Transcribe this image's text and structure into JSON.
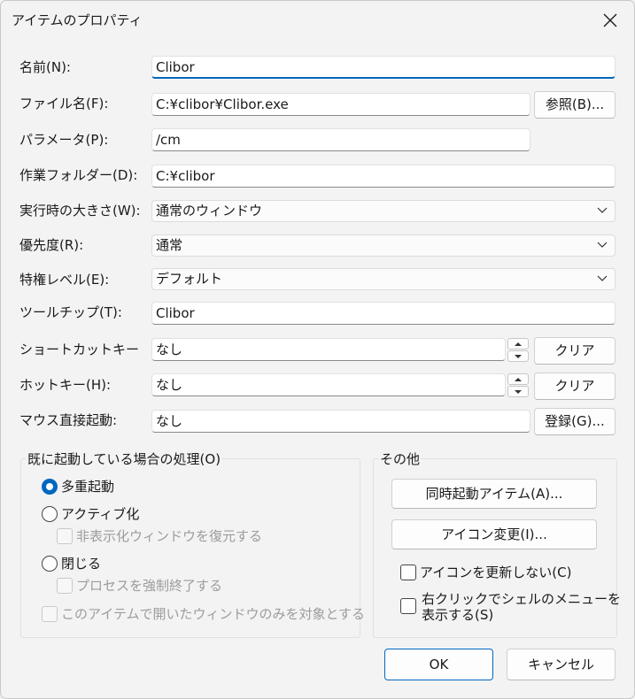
{
  "window": {
    "title": "アイテムのプロパティ",
    "close_icon": "close-icon"
  },
  "fields": {
    "name": {
      "label": "名前(N):",
      "value": "Clibor"
    },
    "filename": {
      "label": "ファイル名(F):",
      "value": "C:¥clibor¥Clibor.exe",
      "browse_label": "参照(B)..."
    },
    "parameters": {
      "label": "パラメータ(P):",
      "value": "/cm"
    },
    "workdir": {
      "label": "作業フォルダー(D):",
      "value": "C:¥clibor"
    },
    "runsize": {
      "label": "実行時の大きさ(W):",
      "value": "通常のウィンドウ"
    },
    "priority": {
      "label": "優先度(R):",
      "value": "通常"
    },
    "privilege": {
      "label": "特権レベル(E):",
      "value": "デフォルト"
    },
    "tooltip": {
      "label": "ツールチップ(T):",
      "value": "Clibor"
    },
    "shortcut": {
      "label": "ショートカットキー",
      "value": "なし",
      "clear_label": "クリア"
    },
    "hotkey": {
      "label": "ホットキー(H):",
      "value": "なし",
      "clear_label": "クリア"
    },
    "mouse": {
      "label": "マウス直接起動:",
      "value": "なし",
      "register_label": "登録(G)..."
    }
  },
  "already_running": {
    "title": "既に起動している場合の処理(O)",
    "multi": "多重起動",
    "activate": "アクティブ化",
    "restore_hidden": "非表示化ウィンドウを復元する",
    "close": "閉じる",
    "force_kill": "プロセスを強制終了する",
    "only_opened": "このアイテムで開いたウィンドウのみを対象とする",
    "selected": "多重起動"
  },
  "other": {
    "title": "その他",
    "simultaneous": "同時起動アイテム(A)...",
    "change_icon": "アイコン変更(I)...",
    "no_update_icon": "アイコンを更新しない(C)",
    "shell_menu_line1": "右クリックでシェルのメニューを",
    "shell_menu_line2": "表示する(S)"
  },
  "buttons": {
    "ok": "OK",
    "cancel": "キャンセル"
  },
  "colors": {
    "accent": "#0067c0",
    "background": "#f3f3f3"
  }
}
